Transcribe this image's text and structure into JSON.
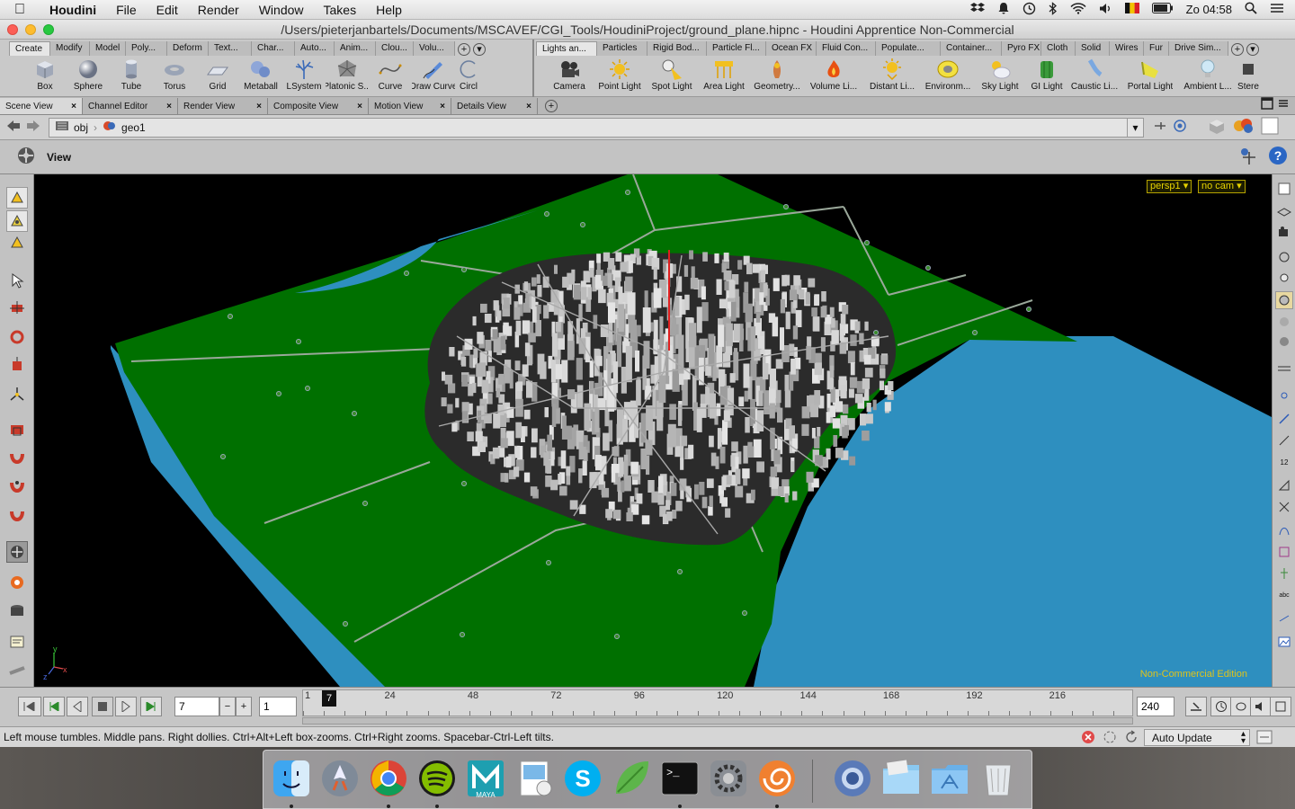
{
  "menubar": {
    "apple": "",
    "app_name": "Houdini",
    "menus": [
      "File",
      "Edit",
      "Render",
      "Window",
      "Takes",
      "Help"
    ],
    "clock": "Zo 04:58"
  },
  "window": {
    "title": "/Users/pieterjanbartels/Documents/MSCAVEF/CGI_Tools/HoudiniProject/ground_plane.hipnc - Houdini Apprentice Non-Commercial"
  },
  "shelf_left": {
    "tabs": [
      "Create",
      "Modify",
      "Model",
      "Poly...",
      "Deform",
      "Text...",
      "Char...",
      "Auto...",
      "Anim...",
      "Clou...",
      "Volu..."
    ],
    "active_tab": "Create",
    "tools": [
      "Box",
      "Sphere",
      "Tube",
      "Torus",
      "Grid",
      "Metaball",
      "LSystem",
      "Platonic S...",
      "Curve",
      "Draw Curve",
      "Circl"
    ]
  },
  "shelf_right": {
    "tabs": [
      "Lights an...",
      "Particles",
      "Rigid Bod...",
      "Particle Fl...",
      "Ocean FX",
      "Fluid Con...",
      "Populate...",
      "Container...",
      "Pyro FX",
      "Cloth",
      "Solid",
      "Wires",
      "Fur",
      "Drive Sim..."
    ],
    "active_tab": "Lights an...",
    "tools": [
      "Camera",
      "Point Light",
      "Spot Light",
      "Area Light",
      "Geometry...",
      "Volume Li...",
      "Distant Li...",
      "Environm...",
      "Sky Light",
      "GI Light",
      "Caustic Li...",
      "Portal Light",
      "Ambient L...",
      "Stere"
    ]
  },
  "pane_tabs": [
    "Scene View",
    "Channel Editor",
    "Render View",
    "Composite View",
    "Motion View",
    "Details View"
  ],
  "path": {
    "root": "obj",
    "node": "geo1"
  },
  "view": {
    "title": "View",
    "camera_menu": "persp1",
    "cam_menu": "no cam",
    "watermark": "Non-Commercial Edition",
    "axis_labels": [
      "y",
      "x",
      "z"
    ],
    "right_tool_labels": [
      "12",
      "abc"
    ]
  },
  "timeline": {
    "current_frame": "7",
    "step": "1",
    "end_frame": "240",
    "ticks": [
      "1",
      "24",
      "48",
      "72",
      "96",
      "120",
      "144",
      "168",
      "192",
      "216"
    ],
    "playhead_label": "7"
  },
  "status": {
    "message": "Left mouse tumbles. Middle pans. Right dollies. Ctrl+Alt+Left box-zooms. Ctrl+Right zooms. Spacebar-Ctrl-Left tilts.",
    "update_mode": "Auto Update"
  },
  "dock": {
    "apps": [
      "finder-icon",
      "launchpad-icon",
      "chrome-icon",
      "spotify-icon",
      "maya-icon",
      "preview-icon",
      "skype-icon",
      "evernote-icon",
      "terminal-icon",
      "system-preferences-icon",
      "houdini-icon",
      "chrome-canary-icon",
      "folder-icon",
      "applications-folder-icon",
      "trash-icon"
    ],
    "maya_label": "MAYA"
  },
  "colors": {
    "ground": "#007000",
    "water": "#2e8fbf",
    "city": "#2b2b2b",
    "building": "#bcbcbc",
    "accent_yellow": "#e6d200"
  }
}
